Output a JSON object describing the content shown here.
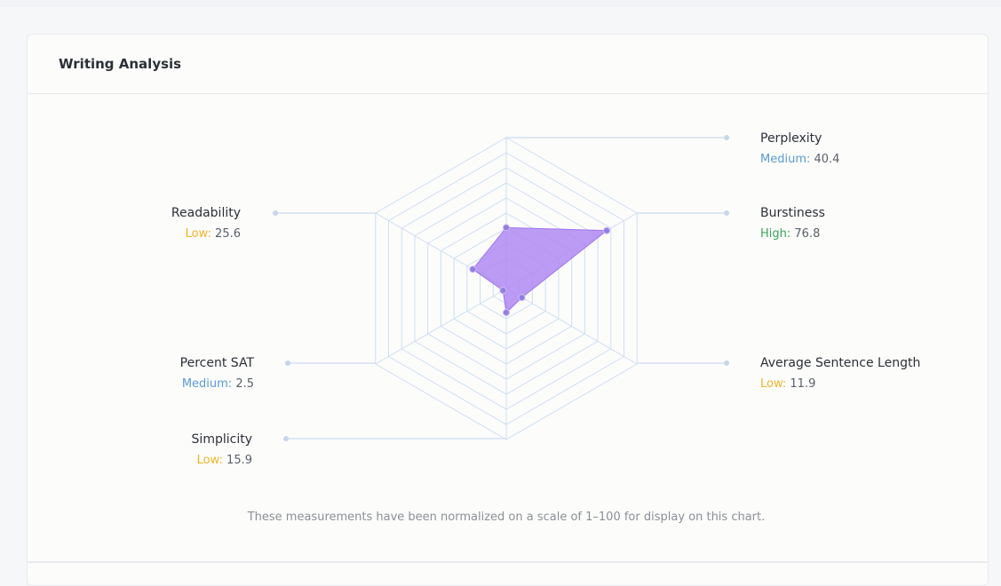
{
  "card": {
    "title": "Writing Analysis"
  },
  "chart_data": {
    "type": "radar",
    "max": 100,
    "levels": 10,
    "categories": [
      "Perplexity",
      "Burstiness",
      "Average Sentence Length",
      "Simplicity",
      "Percent SAT",
      "Readability"
    ],
    "values": [
      40.4,
      76.8,
      11.9,
      15.9,
      2.5,
      25.6
    ],
    "labels": [
      {
        "name": "Perplexity",
        "level": "Medium",
        "value_text": "40.4"
      },
      {
        "name": "Burstiness",
        "level": "High",
        "value_text": "76.8"
      },
      {
        "name": "Average Sentence Length",
        "level": "Low",
        "value_text": "11.9"
      },
      {
        "name": "Simplicity",
        "level": "Low",
        "value_text": "15.9"
      },
      {
        "name": "Percent SAT",
        "level": "Medium",
        "value_text": "2.5"
      },
      {
        "name": "Readability",
        "level": "Low",
        "value_text": "25.6"
      }
    ],
    "level_colors": {
      "Low": "#f0b429",
      "Medium": "#5b9bd5",
      "High": "#3aa55c"
    },
    "fill_color": "#b089f2",
    "grid_color": "#cddff2",
    "note": "These measurements have been normalized on a scale of 1–100 for display on this chart."
  }
}
